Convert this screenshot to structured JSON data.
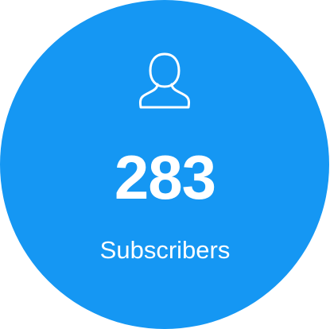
{
  "widget": {
    "icon": "user-icon",
    "count": "283",
    "label": "Subscribers",
    "background_color": "#1597F3",
    "text_color": "#FFFFFF"
  }
}
